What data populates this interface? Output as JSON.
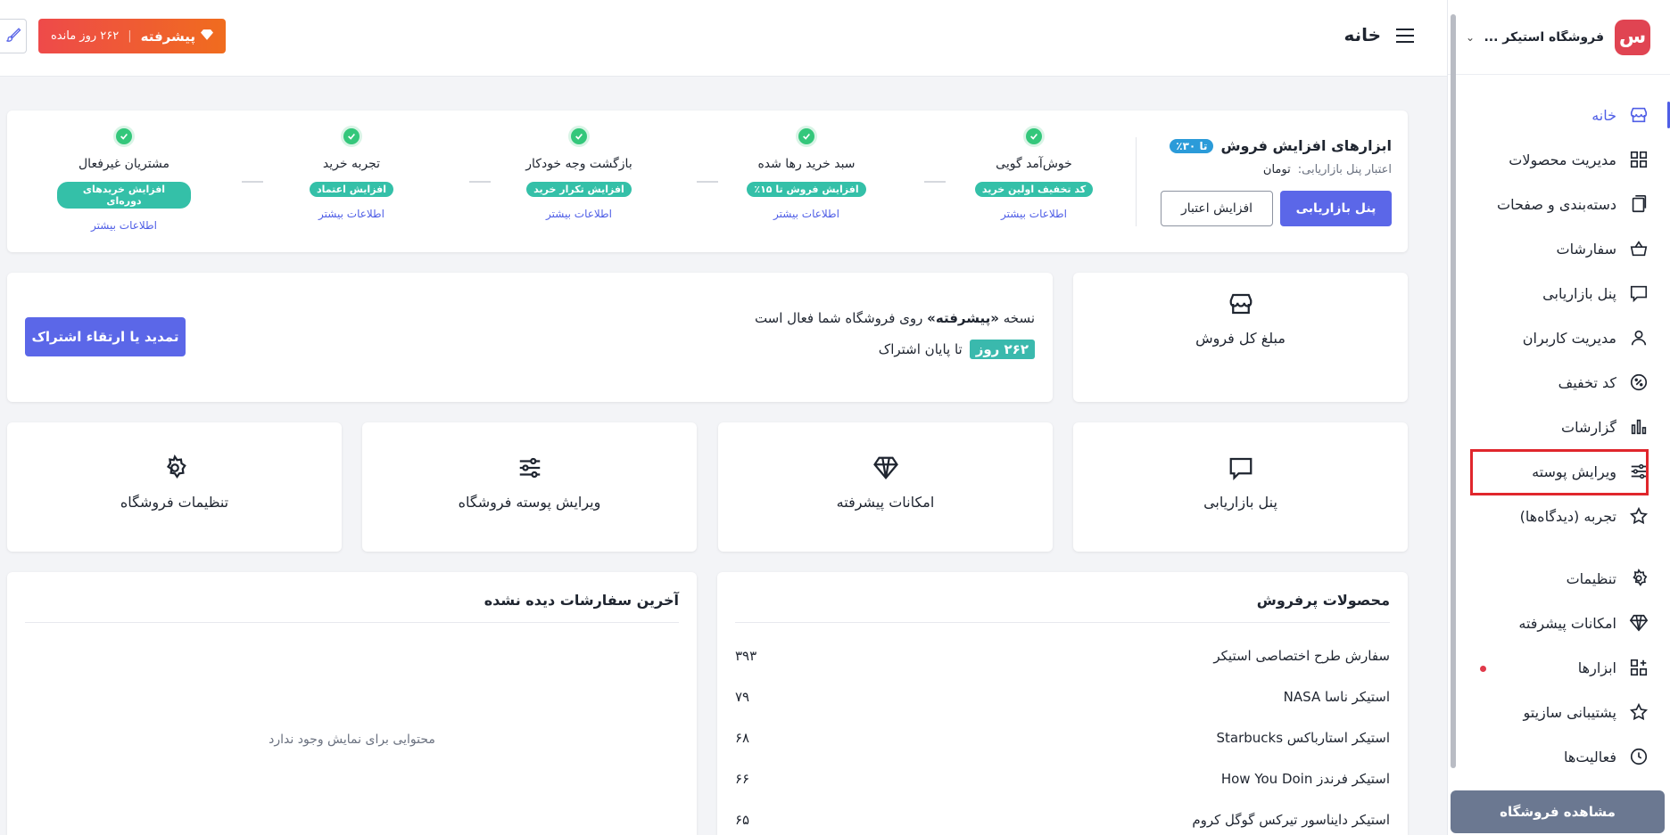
{
  "sidebar": {
    "store_name": "فروشگاه استیکر ...",
    "logo_text": "س",
    "items": [
      {
        "label": "خانه",
        "icon": "store-icon"
      },
      {
        "label": "مدیریت محصولات",
        "icon": "grid-icon"
      },
      {
        "label": "دسته‌بندی و صفحات",
        "icon": "pages-icon"
      },
      {
        "label": "سفارشات",
        "icon": "basket-icon"
      },
      {
        "label": "پنل بازاریابی",
        "icon": "chat-icon"
      },
      {
        "label": "مدیریت کاربران",
        "icon": "user-icon"
      },
      {
        "label": "کد تخفیف",
        "icon": "discount-icon"
      },
      {
        "label": "گزارشات",
        "icon": "chart-icon"
      },
      {
        "label": "ویرایش پوسته",
        "icon": "sliders-icon"
      },
      {
        "label": "تجربه (دیدگاه‌ها)",
        "icon": "star-icon"
      },
      {
        "label": "تنظیمات",
        "icon": "gear-icon"
      },
      {
        "label": "امکانات پیشرفته",
        "icon": "diamond-icon"
      },
      {
        "label": "ابزارها",
        "icon": "widgets-icon"
      },
      {
        "label": "پشتیبانی سازیتو",
        "icon": "star-icon"
      },
      {
        "label": "فعالیت‌ها",
        "icon": "clock-icon"
      }
    ],
    "view_store": "مشاهده فروشگاه"
  },
  "header": {
    "title": "خانه",
    "plan_name": "پیشرفته",
    "plan_days": "۲۶۲ روز مانده"
  },
  "sales_tools": {
    "title": "ابزارهای افزایش فروش",
    "discount_badge": "تا ۳۰٪",
    "credit_label": "اعتبار پنل بازاریابی:",
    "credit_currency": "تومان",
    "marketing_button": "پنل بازاریابی",
    "increase_button": "افزایش اعتبار",
    "tools": [
      {
        "name": "خوش‌آمد گویی",
        "pill": "کد تخفیف اولین خرید",
        "more": "اطلاعات بیشتر"
      },
      {
        "name": "سبد خرید رها شده",
        "pill": "افزایش فروش تا ۱۵٪",
        "more": "اطلاعات بیشتر"
      },
      {
        "name": "بازگشت وجه خودکار",
        "pill": "افزایش تکرار خرید",
        "more": "اطلاعات بیشتر"
      },
      {
        "name": "تجربه خرید",
        "pill": "افزایش اعتماد",
        "more": "اطلاعات بیشتر"
      },
      {
        "name": "مشتریان غیرفعال",
        "pill": "افزایش خریدهای دوره‌ای",
        "more": "اطلاعات بیشتر"
      }
    ]
  },
  "total_sales": {
    "label": "مبلغ کل فروش",
    "icon": "store-icon"
  },
  "subscription": {
    "prefix": "نسخه",
    "plan": "«پیشرفته»",
    "suffix": "روی فروشگاه شما فعال است",
    "days": "۲۶۲ روز",
    "days_suffix": "تا پایان اشتراک",
    "renew_button": "تمدید یا ارتقاء اشتراک"
  },
  "quick_cards": [
    {
      "label": "پنل بازاریابی",
      "icon": "chat-icon"
    },
    {
      "label": "امکانات پیشرفته",
      "icon": "diamond-icon"
    },
    {
      "label": "ویرایش پوسته فروشگاه",
      "icon": "sliders-icon"
    },
    {
      "label": "تنظیمات فروشگاه",
      "icon": "gear-icon"
    }
  ],
  "best_sellers": {
    "title": "محصولات پرفروش",
    "items": [
      {
        "name": "سفارش طرح اختصاصی استیکر",
        "value": "۳۹۳"
      },
      {
        "name": "استیکر ناسا NASA",
        "value": "۷۹"
      },
      {
        "name": "استیکر استارباکس Starbucks",
        "value": "۶۸"
      },
      {
        "name": "استیکر فرندز How You Doin",
        "value": "۶۶"
      },
      {
        "name": "استیکر دایناسور تیرکس گوگل کروم",
        "value": "۶۵"
      }
    ]
  },
  "unseen_orders": {
    "title": "آخرین سفارشات دیده نشده",
    "empty": "محتوایی برای نمایش وجود ندارد"
  }
}
